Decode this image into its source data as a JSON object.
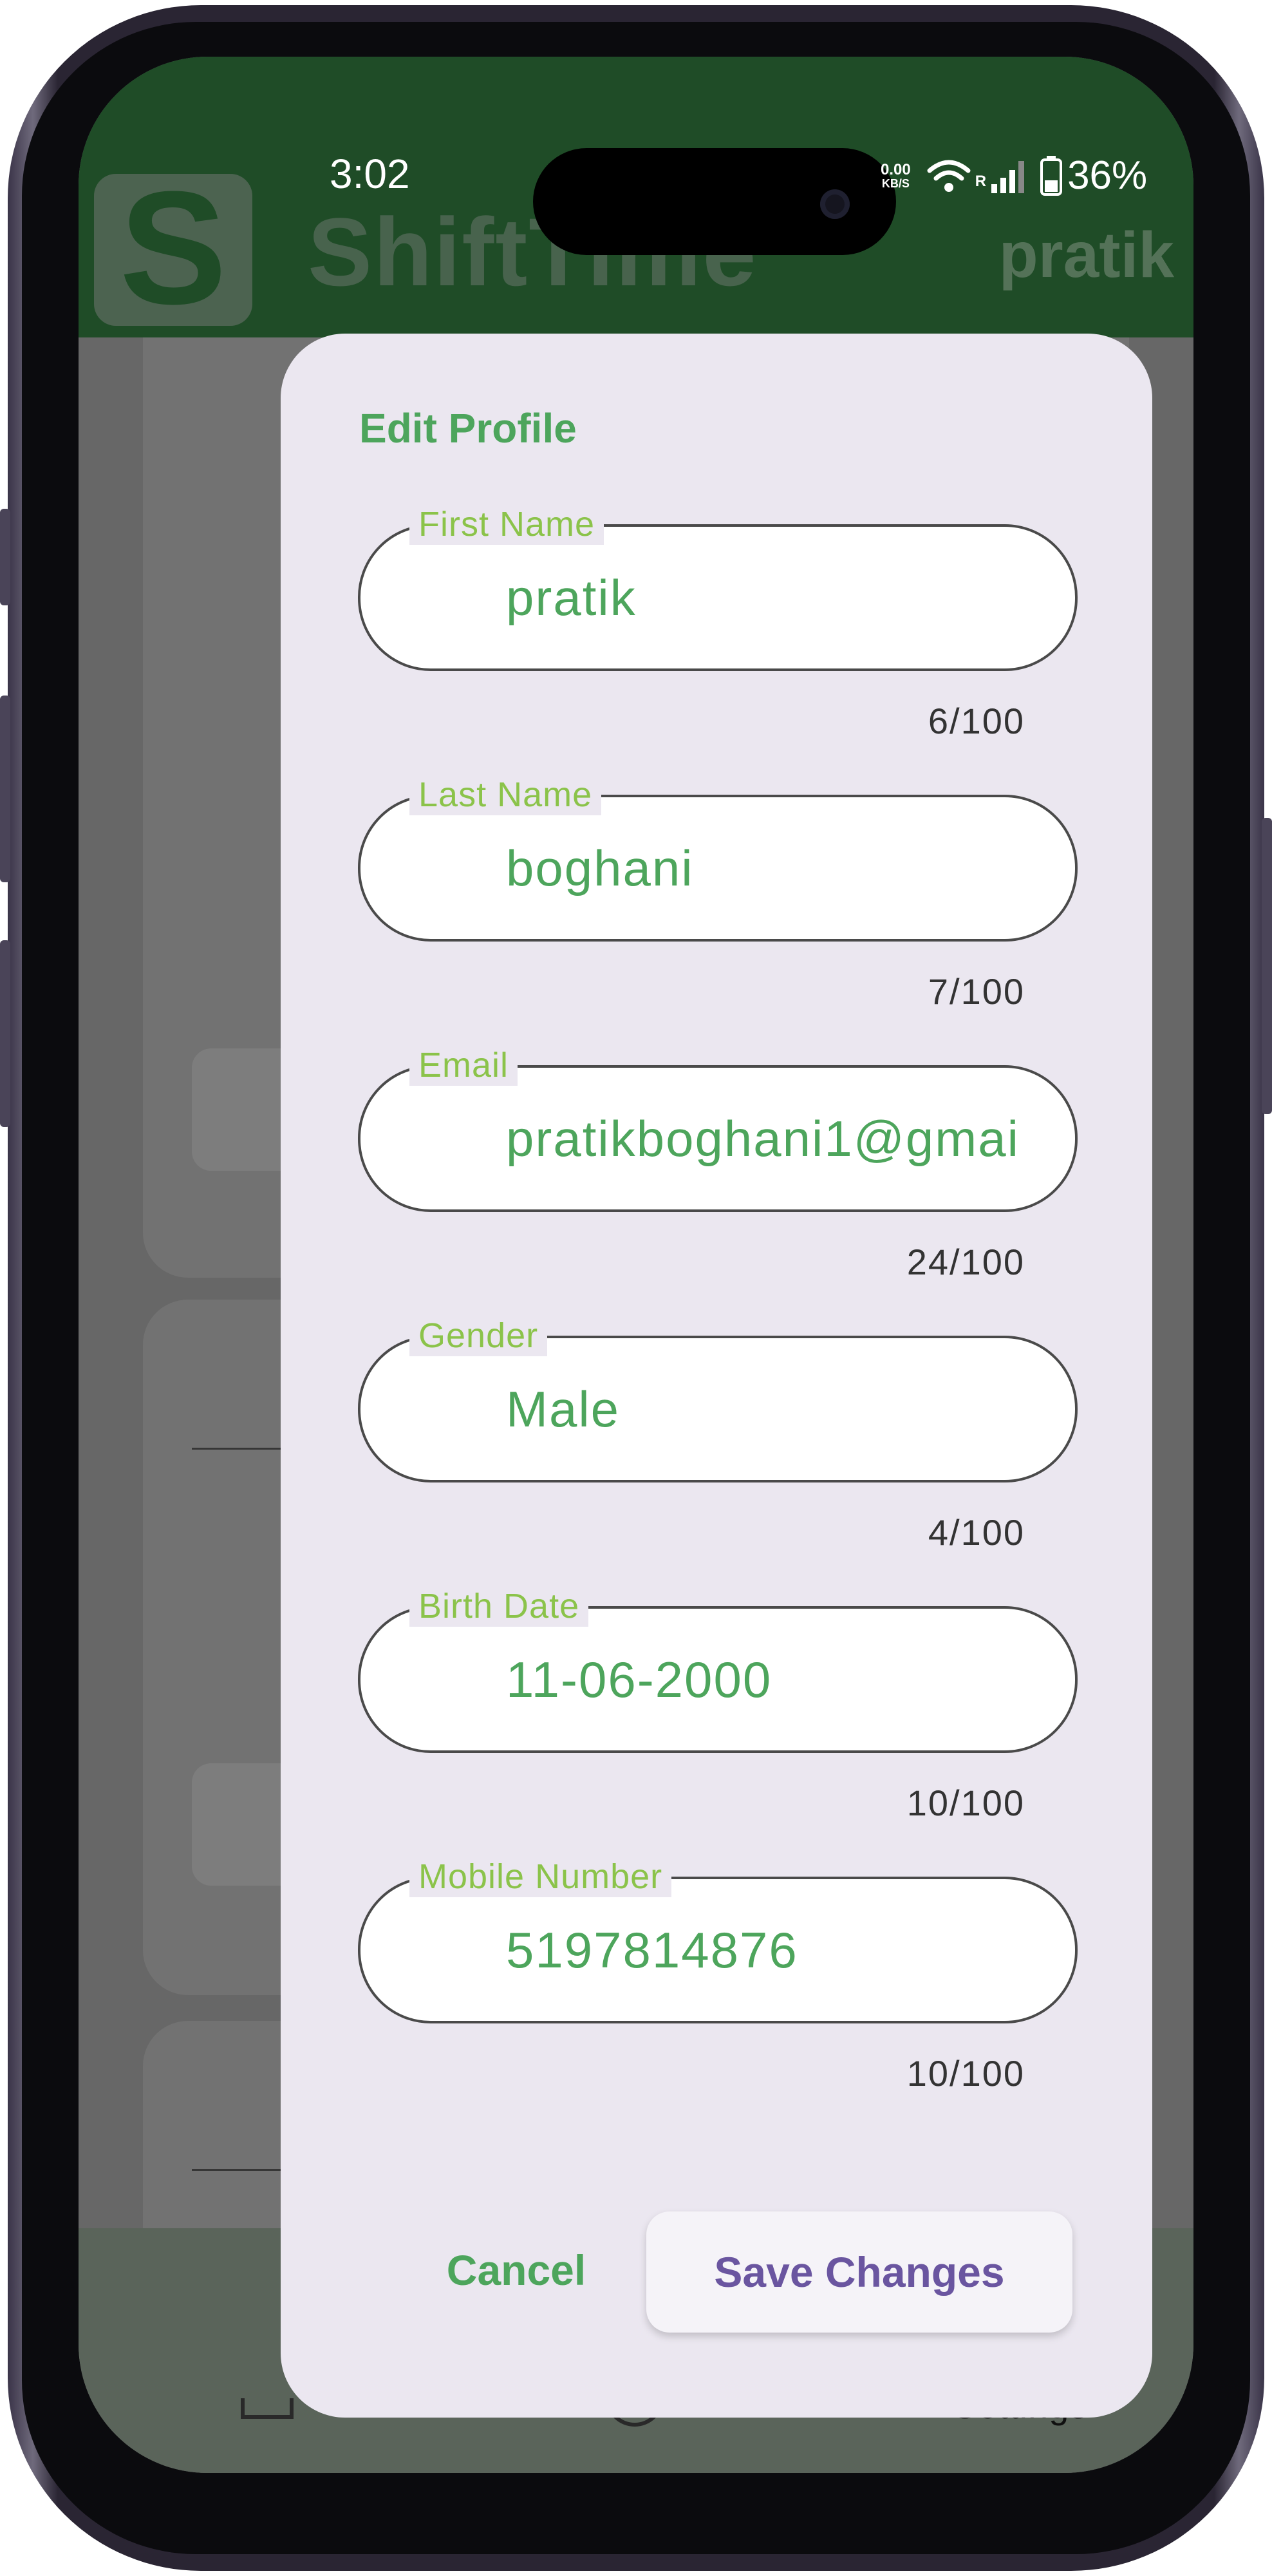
{
  "status_bar": {
    "time": "3:02",
    "net_speed": "0.00",
    "net_unit": "KB/S",
    "network_label": "R",
    "battery": "36%"
  },
  "app": {
    "logo_letter": "S",
    "title": "ShiftTime",
    "user": "pratik"
  },
  "bottom_nav": {
    "settings_label": "Settings"
  },
  "dialog": {
    "title": "Edit Profile",
    "fields": [
      {
        "label": "First Name",
        "value": "pratik",
        "counter": "6/100"
      },
      {
        "label": "Last Name",
        "value": "boghani",
        "counter": "7/100"
      },
      {
        "label": "Email",
        "value": "pratikboghani1@gmai",
        "counter": "24/100"
      },
      {
        "label": "Gender",
        "value": "Male",
        "counter": "4/100"
      },
      {
        "label": "Birth Date",
        "value": "11-06-2000",
        "counter": "10/100"
      },
      {
        "label": "Mobile Number",
        "value": "5197814876",
        "counter": "10/100"
      }
    ],
    "cancel_label": "Cancel",
    "save_label": "Save Changes"
  },
  "colors": {
    "header_green": "#21512a",
    "accent_green": "#4da55c",
    "label_green": "#8bc34a",
    "save_purple": "#6a55a0",
    "dialog_bg": "#ebe7f0"
  },
  "icons": [
    "wifi-icon",
    "signal-icon",
    "battery-icon",
    "logo-icon",
    "home-nav-icon",
    "clock-nav-icon"
  ]
}
